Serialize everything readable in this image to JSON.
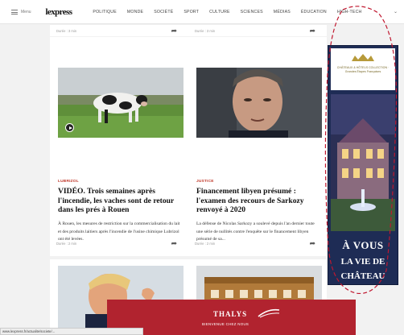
{
  "header": {
    "menu_label": "Menu",
    "logo": "lexpress",
    "nav": [
      "POLITIQUE",
      "MONDE",
      "SOCIÉTÉ",
      "SPORT",
      "CULTURE",
      "SCIENCES",
      "MÉDIAS",
      "ÉDUCATION",
      "HIGH-TECH"
    ]
  },
  "top_cards": [
    {
      "meta": "Durée : 3 min"
    },
    {
      "meta": "Durée : 3 min"
    }
  ],
  "articles": [
    {
      "rubric": "LUBRIZOL",
      "headline": "VIDÉO. Trois semaines après l'incendie, les vaches sont de retour dans les prés à Rouen",
      "excerpt": "À Rouen, les mesures de restriction sur la commercialisation du lait et des produits laitiers après l'incendie de l'usine chimique Lubrizol ont été levées.",
      "meta": "Durée : 2 min"
    },
    {
      "rubric": "JUSTICE",
      "headline": "Financement libyen présumé : l'examen des recours de Sarkozy renvoyé à 2020",
      "excerpt": "La défense de Nicolas Sarkozy a soulevé depuis l'an dernier toute une série de nullités contre l'enquête sur le financement libyen présumé de sa...",
      "meta": "Durée : 2 min"
    }
  ],
  "ad": {
    "logo_text": "CHÂTEAUX & HÔTELS COLLECTION · Grandes Étapes Françaises",
    "line1": "À VOUS",
    "line2": "LA VIE DE",
    "line3": "CHÂTEAU"
  },
  "banner": {
    "brand": "THALYS",
    "sub": "BIENVENUE CHEZ NOUS"
  },
  "statusbar": "www.lexpress.fr/actualite/societe/...",
  "colors": {
    "accent": "#c0392b",
    "banner": "#b1232f",
    "ad_bg": "#1e2c55"
  }
}
